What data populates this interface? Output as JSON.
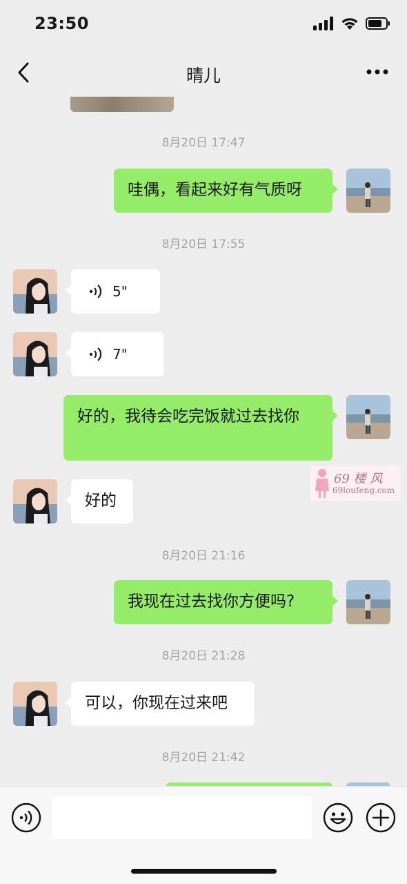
{
  "status": {
    "time": "23:50"
  },
  "nav": {
    "title": "晴儿"
  },
  "messages": [
    {
      "timestamp": "8月20日 17:47"
    },
    {
      "text": "哇偶，看起来好有气质呀"
    },
    {
      "timestamp": "8月20日 17:55"
    },
    {
      "voice_length": "5\""
    },
    {
      "voice_length": "7\""
    },
    {
      "text": "好的，我待会吃完饭就过去找你"
    },
    {
      "text": "好的"
    },
    {
      "timestamp": "8月20日 21:16"
    },
    {
      "text": "我现在过去找你方便吗?"
    },
    {
      "timestamp": "8月20日 21:28"
    },
    {
      "text": "可以，你现在过来吧"
    },
    {
      "timestamp": "8月20日 21:42"
    }
  ],
  "watermark": {
    "line1": "69 楼 风",
    "line2": "69loufeng.com"
  },
  "input": {
    "placeholder": ""
  },
  "colors": {
    "background": "#ededed",
    "my_bubble": "#95ec69",
    "their_bubble": "#ffffff",
    "timestamp": "#a3a3a3"
  }
}
